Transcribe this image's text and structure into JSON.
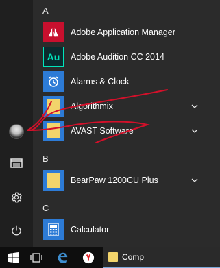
{
  "rail": {
    "items": [
      {
        "name": "user-avatar",
        "icon": "user-avatar"
      },
      {
        "name": "file-explorer",
        "icon": "file-explorer-icon"
      },
      {
        "name": "settings",
        "icon": "gear-icon"
      },
      {
        "name": "power",
        "icon": "power-icon"
      }
    ]
  },
  "apps": {
    "sections": [
      {
        "letter": "A",
        "items": [
          {
            "label": "Adobe Application Manager",
            "icon": "adobe-icon",
            "expandable": false
          },
          {
            "label": "Adobe Audition CC 2014",
            "icon": "audition-icon",
            "tile_text": "Au",
            "expandable": false
          },
          {
            "label": "Alarms & Clock",
            "icon": "alarm-clock-icon",
            "expandable": false
          },
          {
            "label": "Algorithmix",
            "icon": "folder-icon",
            "expandable": true
          },
          {
            "label": "AVAST Software",
            "icon": "folder-icon",
            "expandable": true
          }
        ]
      },
      {
        "letter": "B",
        "items": [
          {
            "label": "BearPaw 1200CU Plus",
            "icon": "folder-icon",
            "expandable": true
          }
        ]
      },
      {
        "letter": "C",
        "items": [
          {
            "label": "Calculator",
            "icon": "calculator-icon",
            "expandable": false
          }
        ]
      }
    ]
  },
  "taskbar": {
    "explorer_label": "Comp",
    "items": [
      "windows-logo-icon",
      "task-view-icon",
      "edge-icon",
      "yandex-icon",
      "file-explorer-icon"
    ]
  },
  "colors": {
    "tile_blue": "#2d7bd6",
    "tile_yellow": "#f2d46b",
    "adobe_red": "#c8102e",
    "audition_bg": "#0b2a2e",
    "audition_fg": "#00e4bb",
    "annotation_red": "#d4102a"
  }
}
